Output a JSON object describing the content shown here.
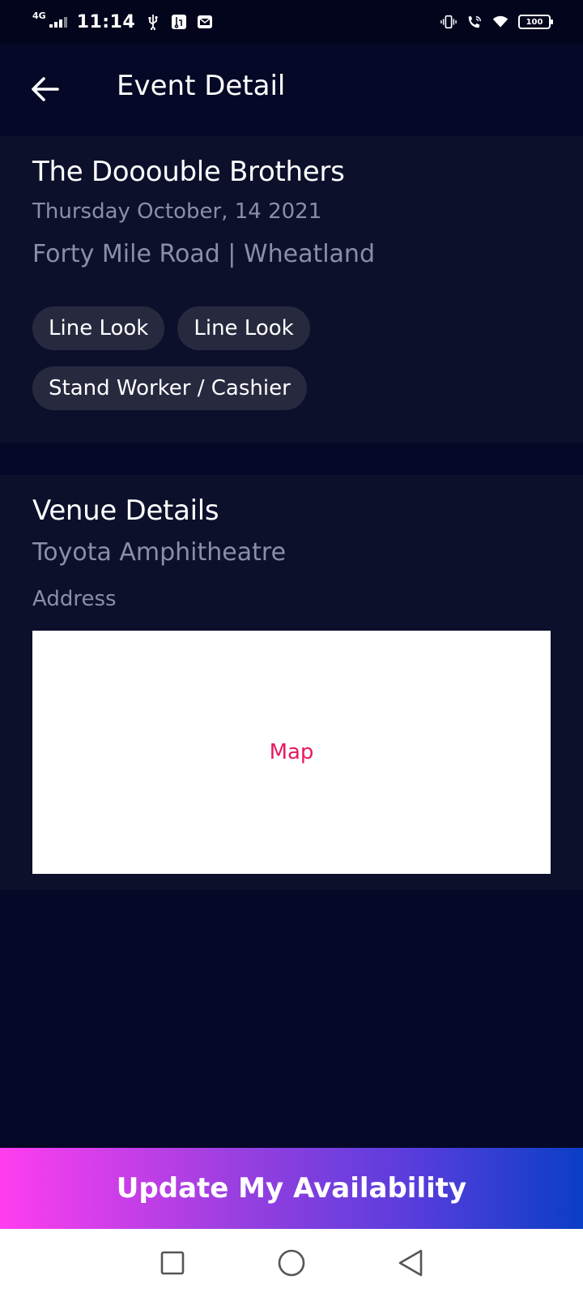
{
  "status_bar": {
    "network": "4G",
    "time": "11:14",
    "battery": "100"
  },
  "header": {
    "title": "Event Detail",
    "back_icon": "arrow-left-icon"
  },
  "event": {
    "title": "The Dooouble Brothers",
    "date": "Thursday October, 14 2021",
    "location": "Forty Mile Road | Wheatland",
    "tags": [
      "Line Look",
      "Line Look",
      "Stand Worker / Cashier"
    ]
  },
  "venue": {
    "section_title": "Venue Details",
    "name": "Toyota Amphitheatre",
    "address_label": "Address",
    "map_label": "Map"
  },
  "cta": {
    "label": "Update My Availability"
  },
  "nav": {
    "recents_icon": "square-icon",
    "home_icon": "circle-icon",
    "back_icon": "triangle-back-icon"
  },
  "colors": {
    "background": "#050826",
    "card": "#0c102b",
    "muted_text": "#8a8ea8",
    "tag_bg": "#272a3f",
    "map_text": "#e8195f",
    "gradient_start": "#ff3df0",
    "gradient_end": "#0a3ec7"
  }
}
